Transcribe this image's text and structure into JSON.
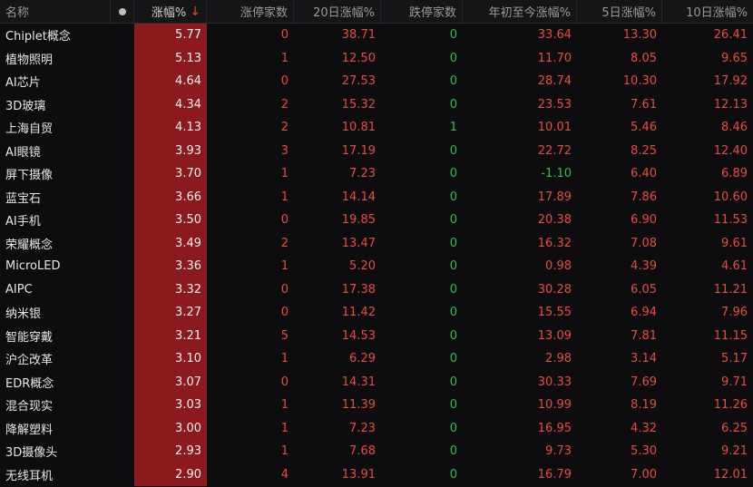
{
  "header": {
    "name": "名称",
    "change_pct": "涨幅%",
    "limit_up": "涨停家数",
    "chg_20d": "20日涨幅%",
    "limit_down": "跌停家数",
    "ytd": "年初至今涨幅%",
    "chg_5d": "5日涨幅%",
    "chg_10d": "10日涨幅%",
    "sort_arrow": "↓"
  },
  "colors": {
    "up": "#e74c3c",
    "down": "#27c04a",
    "highlight": "#8b1a1f"
  },
  "rows": [
    {
      "name": "Chiplet概念",
      "chg": "5.77",
      "limit": "0",
      "d20": "38.71",
      "down": "0",
      "ytd": "33.64",
      "d5": "13.30",
      "d10": "26.41"
    },
    {
      "name": "植物照明",
      "chg": "5.13",
      "limit": "1",
      "d20": "12.50",
      "down": "0",
      "ytd": "11.70",
      "d5": "8.05",
      "d10": "9.65"
    },
    {
      "name": "AI芯片",
      "chg": "4.64",
      "limit": "0",
      "d20": "27.53",
      "down": "0",
      "ytd": "28.74",
      "d5": "10.30",
      "d10": "17.92"
    },
    {
      "name": "3D玻璃",
      "chg": "4.34",
      "limit": "2",
      "d20": "15.32",
      "down": "0",
      "ytd": "23.53",
      "d5": "7.61",
      "d10": "12.13"
    },
    {
      "name": "上海自贸",
      "chg": "4.13",
      "limit": "2",
      "d20": "10.81",
      "down": "1",
      "ytd": "10.01",
      "d5": "5.46",
      "d10": "8.46"
    },
    {
      "name": "AI眼镜",
      "chg": "3.93",
      "limit": "3",
      "d20": "17.19",
      "down": "0",
      "ytd": "22.72",
      "d5": "8.25",
      "d10": "12.40"
    },
    {
      "name": "屏下摄像",
      "chg": "3.70",
      "limit": "1",
      "d20": "7.23",
      "down": "0",
      "ytd": "-1.10",
      "d5": "6.40",
      "d10": "6.89"
    },
    {
      "name": "蓝宝石",
      "chg": "3.66",
      "limit": "1",
      "d20": "14.14",
      "down": "0",
      "ytd": "17.89",
      "d5": "7.86",
      "d10": "10.60"
    },
    {
      "name": "AI手机",
      "chg": "3.50",
      "limit": "0",
      "d20": "19.85",
      "down": "0",
      "ytd": "20.38",
      "d5": "6.90",
      "d10": "11.53"
    },
    {
      "name": "荣耀概念",
      "chg": "3.49",
      "limit": "2",
      "d20": "13.47",
      "down": "0",
      "ytd": "16.32",
      "d5": "7.08",
      "d10": "9.61"
    },
    {
      "name": "MicroLED",
      "chg": "3.36",
      "limit": "1",
      "d20": "5.20",
      "down": "0",
      "ytd": "0.98",
      "d5": "4.39",
      "d10": "4.61"
    },
    {
      "name": "AIPC",
      "chg": "3.32",
      "limit": "0",
      "d20": "17.38",
      "down": "0",
      "ytd": "30.28",
      "d5": "6.05",
      "d10": "11.21"
    },
    {
      "name": "纳米银",
      "chg": "3.27",
      "limit": "0",
      "d20": "11.42",
      "down": "0",
      "ytd": "15.55",
      "d5": "6.94",
      "d10": "7.96"
    },
    {
      "name": "智能穿戴",
      "chg": "3.21",
      "limit": "5",
      "d20": "14.53",
      "down": "0",
      "ytd": "13.09",
      "d5": "7.81",
      "d10": "11.15"
    },
    {
      "name": "沪企改革",
      "chg": "3.10",
      "limit": "1",
      "d20": "6.29",
      "down": "0",
      "ytd": "2.98",
      "d5": "3.14",
      "d10": "5.17"
    },
    {
      "name": "EDR概念",
      "chg": "3.07",
      "limit": "0",
      "d20": "14.31",
      "down": "0",
      "ytd": "30.33",
      "d5": "7.69",
      "d10": "9.71"
    },
    {
      "name": "混合现实",
      "chg": "3.03",
      "limit": "1",
      "d20": "11.39",
      "down": "0",
      "ytd": "10.99",
      "d5": "8.19",
      "d10": "11.26"
    },
    {
      "name": "降解塑料",
      "chg": "3.00",
      "limit": "1",
      "d20": "7.23",
      "down": "0",
      "ytd": "16.95",
      "d5": "4.32",
      "d10": "6.25"
    },
    {
      "name": "3D摄像头",
      "chg": "2.93",
      "limit": "1",
      "d20": "7.68",
      "down": "0",
      "ytd": "9.73",
      "d5": "5.30",
      "d10": "9.21"
    },
    {
      "name": "无线耳机",
      "chg": "2.90",
      "limit": "4",
      "d20": "13.91",
      "down": "0",
      "ytd": "16.79",
      "d5": "7.00",
      "d10": "12.01"
    }
  ]
}
